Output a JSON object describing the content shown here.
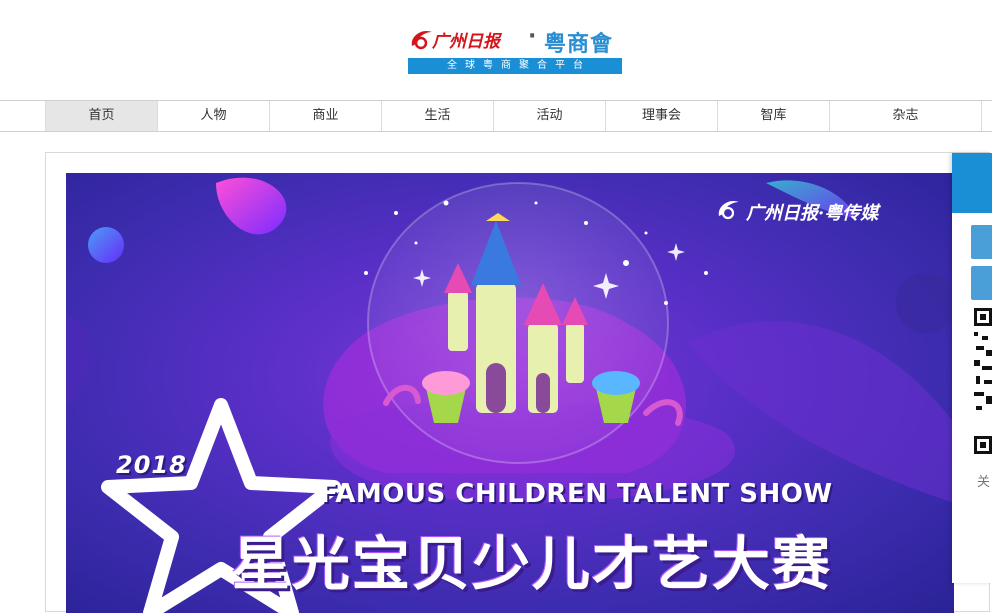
{
  "header": {
    "logo_paper": "广州日报",
    "logo_dot": "·",
    "logo_brand": "粤商會",
    "logo_tagline": "全球粤商聚合平台"
  },
  "nav": {
    "items": [
      {
        "label": "首页",
        "active": true
      },
      {
        "label": "人物"
      },
      {
        "label": "商业"
      },
      {
        "label": "生活"
      },
      {
        "label": "活动"
      },
      {
        "label": "理事会"
      },
      {
        "label": "智库"
      },
      {
        "label": "杂志"
      }
    ]
  },
  "banner": {
    "brand": "广州日报·粤传媒",
    "year": "2018",
    "title_en": "FAMOUS CHILDREN TALENT SHOW",
    "title_cn": "星光宝贝少儿才艺大赛"
  },
  "float_panel": {
    "label": "关"
  },
  "colors": {
    "brand_blue": "#1a8fd6",
    "brand_red": "#d3161b",
    "nav_active_bg": "#e6e6e6"
  }
}
